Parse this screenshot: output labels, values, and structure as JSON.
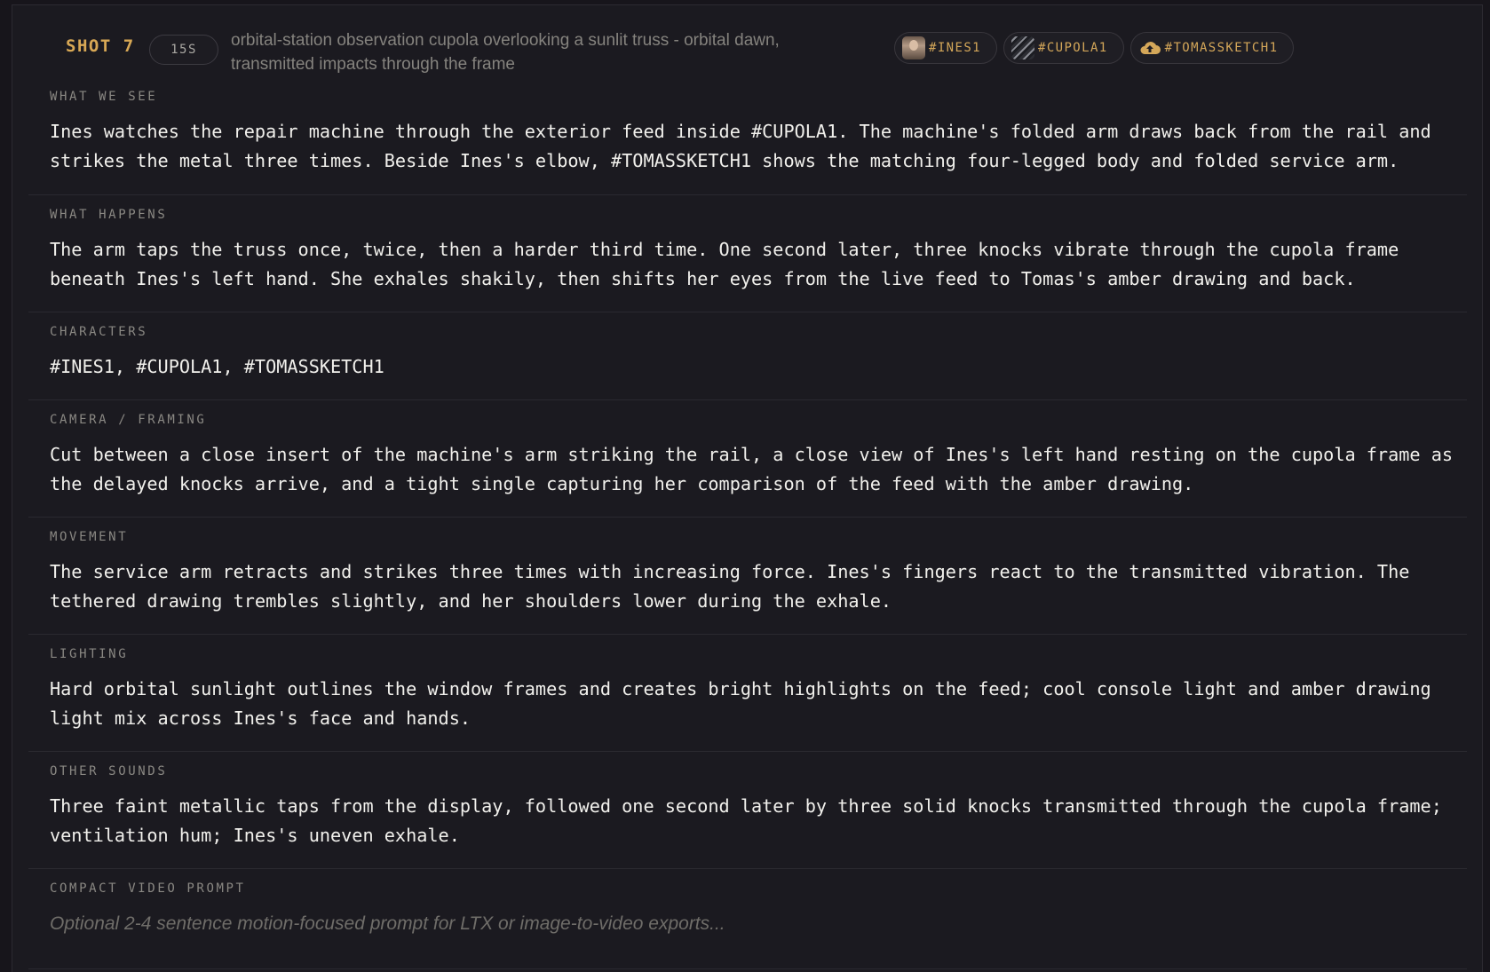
{
  "header": {
    "shot_label": "SHOT 7",
    "duration": "15S",
    "description": "orbital-station observation cupola overlooking a sunlit truss - orbital dawn, transmitted impacts through the frame",
    "tags": [
      {
        "label": "#INES1",
        "icon": "portrait-thumbnail"
      },
      {
        "label": "#CUPOLA1",
        "icon": "cupola-thumbnail"
      },
      {
        "label": "#TOMASSKETCH1",
        "icon": "cloud-upload-icon"
      }
    ]
  },
  "sections": {
    "what_we_see": {
      "title": "WHAT WE SEE",
      "body": "Ines watches the repair machine through the exterior feed inside #CUPOLA1. The machine's folded arm draws back from the rail and strikes the metal three times. Beside Ines's elbow, #TOMASSKETCH1 shows the matching four-legged body and folded service arm."
    },
    "what_happens": {
      "title": "WHAT HAPPENS",
      "body": "The arm taps the truss once, twice, then a harder third time. One second later, three knocks vibrate through the cupola frame beneath Ines's left hand. She exhales shakily, then shifts her eyes from the live feed to Tomas's amber drawing and back."
    },
    "characters": {
      "title": "CHARACTERS",
      "body": "#INES1, #CUPOLA1, #TOMASSKETCH1"
    },
    "camera": {
      "title": "CAMERA / FRAMING",
      "body": "Cut between a close insert of the machine's arm striking the rail, a close view of Ines's left hand resting on the cupola frame as the delayed knocks arrive, and a tight single capturing her comparison of the feed with the amber drawing."
    },
    "movement": {
      "title": "MOVEMENT",
      "body": "The service arm retracts and strikes three times with increasing force. Ines's fingers react to the transmitted vibration. The tethered drawing trembles slightly, and her shoulders lower during the exhale."
    },
    "lighting": {
      "title": "LIGHTING",
      "body": "Hard orbital sunlight outlines the window frames and creates bright highlights on the feed; cool console light and amber drawing light mix across Ines's face and hands."
    },
    "other_sounds": {
      "title": "OTHER SOUNDS",
      "body": "Three faint metallic taps from the display, followed one second later by three solid knocks transmitted through the cupola frame; ventilation hum; Ines's uneven exhale."
    },
    "compact_prompt": {
      "title": "COMPACT VIDEO PROMPT",
      "placeholder": "Optional 2-4 sentence motion-focused prompt for LTX or image-to-video exports..."
    }
  },
  "colors": {
    "background": "#17151b",
    "panel": "#1b1a20",
    "accent": "#d8a855",
    "text": "#f1f0ec",
    "muted": "#8a8883"
  }
}
